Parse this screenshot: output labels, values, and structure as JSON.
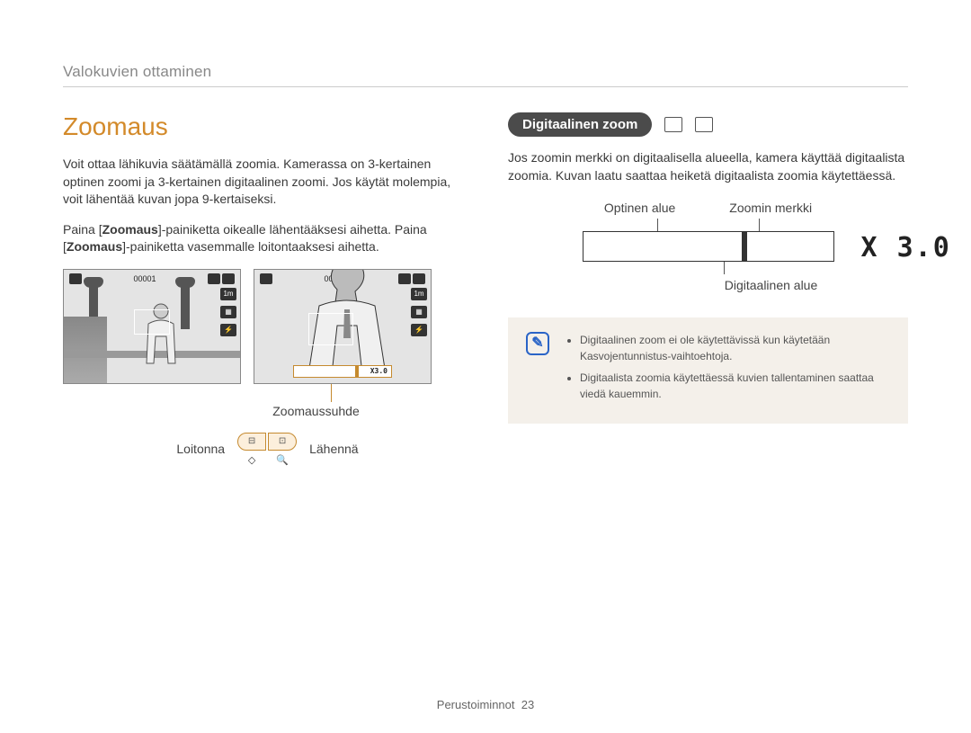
{
  "breadcrumb": "Valokuvien ottaminen",
  "left": {
    "title": "Zoomaus",
    "para1": "Voit ottaa lähikuvia säätämällä zoomia. Kamerassa on 3-kertainen optinen zoomi ja 3-kertainen digitaalinen zoomi. Jos käytät molempia, voit lähentää kuvan jopa 9-kertaiseksi.",
    "para2_pre": "Paina [",
    "para2_bold1": "Zoomaus",
    "para2_mid": "]-painiketta oikealle lähentääksesi aihetta. Paina [",
    "para2_bold2": "Zoomaus",
    "para2_post": "]-painiketta vasemmalle loitontaaksesi aihetta.",
    "lcd_counter": "00001",
    "lcd_icon_1m": "1m",
    "zoom_bar_text": "X3.0",
    "zoom_ratio_label": "Zoomaussuhde",
    "zoom_out": "Loitonna",
    "zoom_in": "Lähennä"
  },
  "right": {
    "chip": "Digitaalinen zoom",
    "para": "Jos zoomin merkki on digitaalisella alueella, kamera käyttää digitaalista zoomia. Kuvan laatu saattaa heiketä digitaalista zoomia käytettäessä.",
    "label_optical": "Optinen alue",
    "label_indicator": "Zoomin merkki",
    "label_digital": "Digitaalinen alue",
    "x30": "X 3.0",
    "notes": [
      "Digitaalinen zoom ei ole käytettävissä kun käytetään Kasvojentunnistus-vaihtoehtoja.",
      "Digitaalista zoomia käytettäessä kuvien tallentaminen saattaa viedä kauemmin."
    ]
  },
  "footer": {
    "section": "Perustoiminnot",
    "page": "23"
  }
}
